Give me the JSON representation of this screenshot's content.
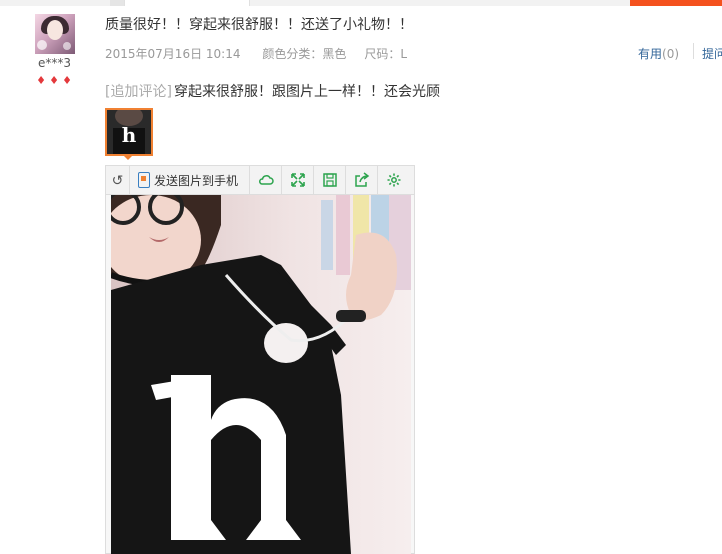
{
  "colors": {
    "accent": "#f4511e",
    "thumbnail_border": "#f08132",
    "link": "#336699",
    "meta_text": "#999999",
    "toolbar_icon": "#2da44e"
  },
  "reviewer": {
    "username": "e***3",
    "level_icons": [
      "gem-icon",
      "gem-icon",
      "gem-icon"
    ]
  },
  "review": {
    "text": "质量很好！！穿起来很舒服！！还送了小礼物！！",
    "date": "2015年07月16日 10:14",
    "color_label": "颜色分类：黑色",
    "size_label": "尺码：L",
    "useful_label": "有用",
    "useful_count": "(0)",
    "reply_label": "提问"
  },
  "append": {
    "label": "[追加评论]",
    "text": "穿起来很舒服！跟图片上一样！！还会光顾"
  },
  "viewer": {
    "send_label": "发送图片到手机",
    "tools": [
      "cloud-icon",
      "expand-icon",
      "save-icon",
      "share-icon",
      "settings-icon"
    ]
  }
}
